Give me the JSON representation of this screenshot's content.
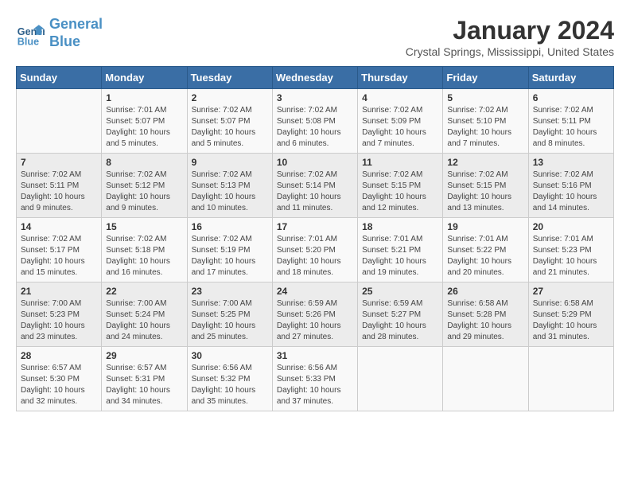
{
  "logo": {
    "name_part1": "General",
    "name_part2": "Blue"
  },
  "title": "January 2024",
  "subtitle": "Crystal Springs, Mississippi, United States",
  "header": {
    "days": [
      "Sunday",
      "Monday",
      "Tuesday",
      "Wednesday",
      "Thursday",
      "Friday",
      "Saturday"
    ]
  },
  "weeks": [
    [
      {
        "day": "",
        "info": ""
      },
      {
        "day": "1",
        "info": "Sunrise: 7:01 AM\nSunset: 5:07 PM\nDaylight: 10 hours\nand 5 minutes."
      },
      {
        "day": "2",
        "info": "Sunrise: 7:02 AM\nSunset: 5:07 PM\nDaylight: 10 hours\nand 5 minutes."
      },
      {
        "day": "3",
        "info": "Sunrise: 7:02 AM\nSunset: 5:08 PM\nDaylight: 10 hours\nand 6 minutes."
      },
      {
        "day": "4",
        "info": "Sunrise: 7:02 AM\nSunset: 5:09 PM\nDaylight: 10 hours\nand 7 minutes."
      },
      {
        "day": "5",
        "info": "Sunrise: 7:02 AM\nSunset: 5:10 PM\nDaylight: 10 hours\nand 7 minutes."
      },
      {
        "day": "6",
        "info": "Sunrise: 7:02 AM\nSunset: 5:11 PM\nDaylight: 10 hours\nand 8 minutes."
      }
    ],
    [
      {
        "day": "7",
        "info": "Sunrise: 7:02 AM\nSunset: 5:11 PM\nDaylight: 10 hours\nand 9 minutes."
      },
      {
        "day": "8",
        "info": "Sunrise: 7:02 AM\nSunset: 5:12 PM\nDaylight: 10 hours\nand 9 minutes."
      },
      {
        "day": "9",
        "info": "Sunrise: 7:02 AM\nSunset: 5:13 PM\nDaylight: 10 hours\nand 10 minutes."
      },
      {
        "day": "10",
        "info": "Sunrise: 7:02 AM\nSunset: 5:14 PM\nDaylight: 10 hours\nand 11 minutes."
      },
      {
        "day": "11",
        "info": "Sunrise: 7:02 AM\nSunset: 5:15 PM\nDaylight: 10 hours\nand 12 minutes."
      },
      {
        "day": "12",
        "info": "Sunrise: 7:02 AM\nSunset: 5:15 PM\nDaylight: 10 hours\nand 13 minutes."
      },
      {
        "day": "13",
        "info": "Sunrise: 7:02 AM\nSunset: 5:16 PM\nDaylight: 10 hours\nand 14 minutes."
      }
    ],
    [
      {
        "day": "14",
        "info": "Sunrise: 7:02 AM\nSunset: 5:17 PM\nDaylight: 10 hours\nand 15 minutes."
      },
      {
        "day": "15",
        "info": "Sunrise: 7:02 AM\nSunset: 5:18 PM\nDaylight: 10 hours\nand 16 minutes."
      },
      {
        "day": "16",
        "info": "Sunrise: 7:02 AM\nSunset: 5:19 PM\nDaylight: 10 hours\nand 17 minutes."
      },
      {
        "day": "17",
        "info": "Sunrise: 7:01 AM\nSunset: 5:20 PM\nDaylight: 10 hours\nand 18 minutes."
      },
      {
        "day": "18",
        "info": "Sunrise: 7:01 AM\nSunset: 5:21 PM\nDaylight: 10 hours\nand 19 minutes."
      },
      {
        "day": "19",
        "info": "Sunrise: 7:01 AM\nSunset: 5:22 PM\nDaylight: 10 hours\nand 20 minutes."
      },
      {
        "day": "20",
        "info": "Sunrise: 7:01 AM\nSunset: 5:23 PM\nDaylight: 10 hours\nand 21 minutes."
      }
    ],
    [
      {
        "day": "21",
        "info": "Sunrise: 7:00 AM\nSunset: 5:23 PM\nDaylight: 10 hours\nand 23 minutes."
      },
      {
        "day": "22",
        "info": "Sunrise: 7:00 AM\nSunset: 5:24 PM\nDaylight: 10 hours\nand 24 minutes."
      },
      {
        "day": "23",
        "info": "Sunrise: 7:00 AM\nSunset: 5:25 PM\nDaylight: 10 hours\nand 25 minutes."
      },
      {
        "day": "24",
        "info": "Sunrise: 6:59 AM\nSunset: 5:26 PM\nDaylight: 10 hours\nand 27 minutes."
      },
      {
        "day": "25",
        "info": "Sunrise: 6:59 AM\nSunset: 5:27 PM\nDaylight: 10 hours\nand 28 minutes."
      },
      {
        "day": "26",
        "info": "Sunrise: 6:58 AM\nSunset: 5:28 PM\nDaylight: 10 hours\nand 29 minutes."
      },
      {
        "day": "27",
        "info": "Sunrise: 6:58 AM\nSunset: 5:29 PM\nDaylight: 10 hours\nand 31 minutes."
      }
    ],
    [
      {
        "day": "28",
        "info": "Sunrise: 6:57 AM\nSunset: 5:30 PM\nDaylight: 10 hours\nand 32 minutes."
      },
      {
        "day": "29",
        "info": "Sunrise: 6:57 AM\nSunset: 5:31 PM\nDaylight: 10 hours\nand 34 minutes."
      },
      {
        "day": "30",
        "info": "Sunrise: 6:56 AM\nSunset: 5:32 PM\nDaylight: 10 hours\nand 35 minutes."
      },
      {
        "day": "31",
        "info": "Sunrise: 6:56 AM\nSunset: 5:33 PM\nDaylight: 10 hours\nand 37 minutes."
      },
      {
        "day": "",
        "info": ""
      },
      {
        "day": "",
        "info": ""
      },
      {
        "day": "",
        "info": ""
      }
    ]
  ]
}
